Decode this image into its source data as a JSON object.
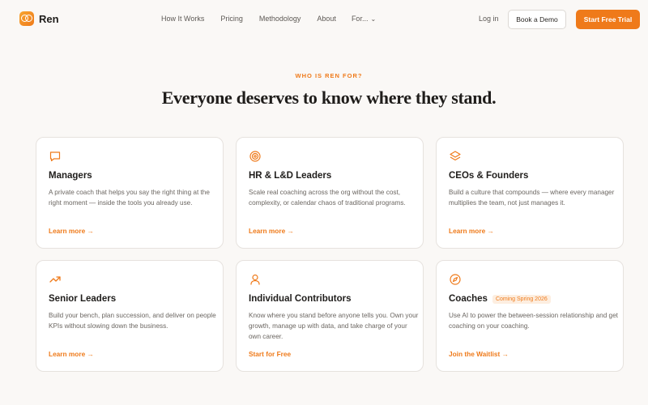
{
  "brand": {
    "name": "Ren",
    "accent": "#ef7a1a"
  },
  "nav": {
    "items": [
      "How It Works",
      "Pricing",
      "Methodology",
      "About",
      "For..."
    ],
    "login": "Log in",
    "demo": "Book a Demo",
    "trial": "Start Free Trial"
  },
  "hero": {
    "eyebrow": "WHO IS REN FOR?",
    "headline": "Everyone deserves to know where they stand."
  },
  "cards": [
    {
      "icon": "chat-bubble-icon",
      "title": "Managers",
      "badge": "",
      "desc": "A private coach that helps you say the right thing at the right moment — inside the tools you already use.",
      "cta": "Learn more →"
    },
    {
      "icon": "target-icon",
      "title": "HR & L&D Leaders",
      "badge": "",
      "desc": "Scale real coaching across the org without the cost, complexity, or calendar chaos of traditional programs.",
      "cta": "Learn more →"
    },
    {
      "icon": "layers-icon",
      "title": "CEOs & Founders",
      "badge": "",
      "desc": "Build a culture that compounds — where every manager multiplies the team, not just manages it.",
      "cta": "Learn more →"
    },
    {
      "icon": "trending-up-icon",
      "title": "Senior Leaders",
      "badge": "",
      "desc": "Build your bench, plan succession, and deliver on people KPIs without slowing down the business.",
      "cta": "Learn more →"
    },
    {
      "icon": "user-icon",
      "title": "Individual Contributors",
      "badge": "",
      "desc": "Know where you stand before anyone tells you. Own your growth, manage up with data, and take charge of your own career.",
      "cta": "Start for Free"
    },
    {
      "icon": "compass-icon",
      "title": "Coaches",
      "badge": "Coming Spring 2026",
      "desc": "Use AI to power the between-session relationship and get coaching on your coaching.",
      "cta": "Join the Waitlist →"
    }
  ]
}
